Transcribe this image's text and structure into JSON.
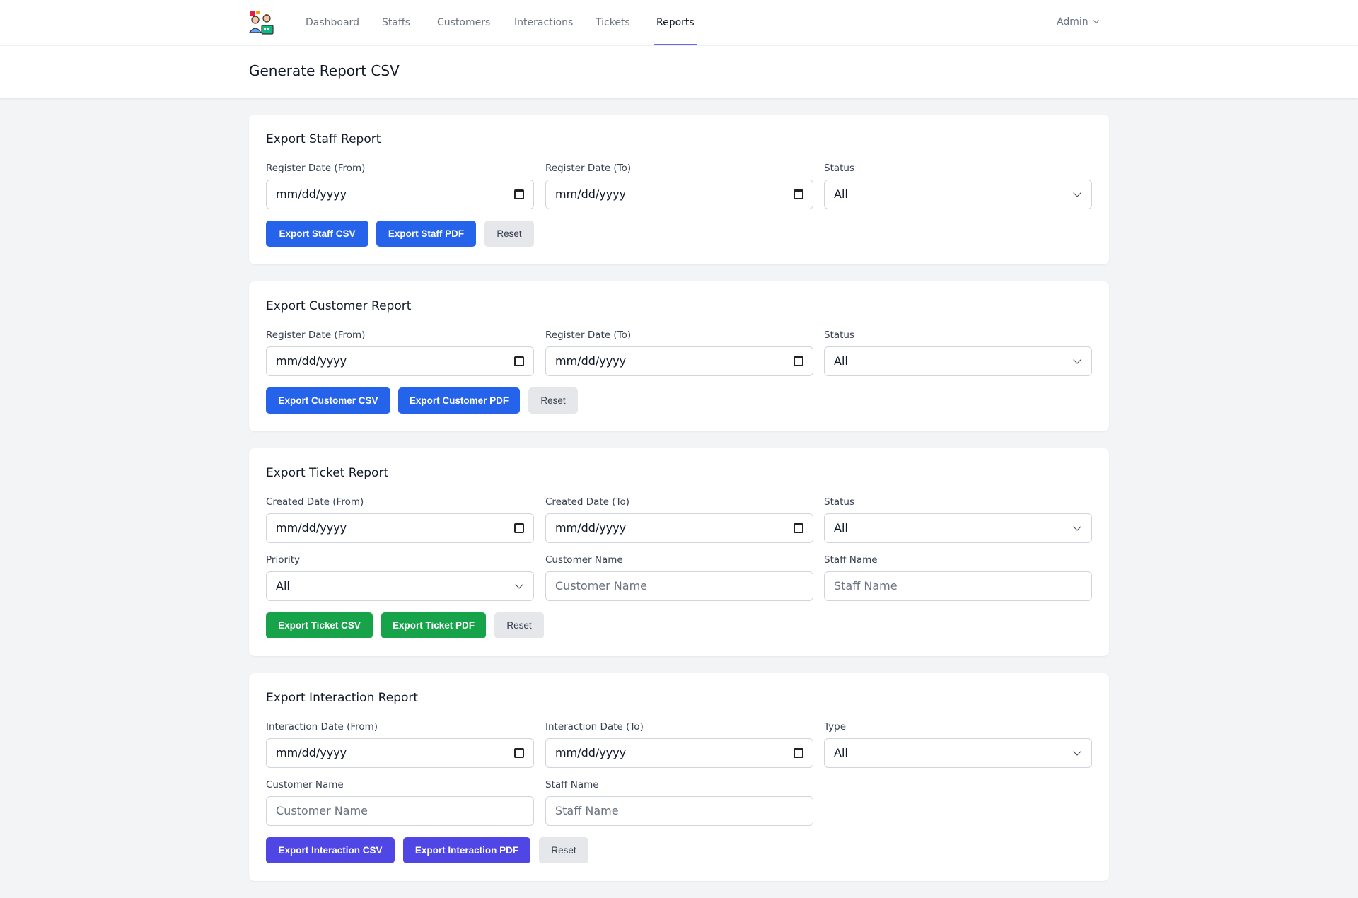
{
  "nav": {
    "items": [
      {
        "label": "Dashboard"
      },
      {
        "label": "Staffs"
      },
      {
        "label": "Customers"
      },
      {
        "label": "Interactions"
      },
      {
        "label": "Tickets"
      },
      {
        "label": "Reports"
      }
    ],
    "active": "Reports",
    "user": "Admin"
  },
  "page": {
    "title": "Generate Report CSV"
  },
  "date_placeholder": "mm/dd/yyyy",
  "staff_report": {
    "title": "Export Staff Report",
    "from_label": "Register Date (From)",
    "to_label": "Register Date (To)",
    "status_label": "Status",
    "status_value": "All",
    "csv_button": "Export Staff CSV",
    "pdf_button": "Export Staff PDF",
    "reset_button": "Reset"
  },
  "customer_report": {
    "title": "Export Customer Report",
    "from_label": "Register Date (From)",
    "to_label": "Register Date (To)",
    "status_label": "Status",
    "status_value": "All",
    "csv_button": "Export Customer CSV",
    "pdf_button": "Export Customer PDF",
    "reset_button": "Reset"
  },
  "ticket_report": {
    "title": "Export Ticket Report",
    "from_label": "Created Date (From)",
    "to_label": "Created Date (To)",
    "status_label": "Status",
    "status_value": "All",
    "priority_label": "Priority",
    "priority_value": "All",
    "customer_label": "Customer Name",
    "customer_placeholder": "Customer Name",
    "staff_label": "Staff Name",
    "staff_placeholder": "Staff Name",
    "csv_button": "Export Ticket CSV",
    "pdf_button": "Export Ticket PDF",
    "reset_button": "Reset"
  },
  "interaction_report": {
    "title": "Export Interaction Report",
    "from_label": "Interaction Date (From)",
    "to_label": "Interaction Date (To)",
    "type_label": "Type",
    "type_value": "All",
    "customer_label": "Customer Name",
    "customer_placeholder": "Customer Name",
    "staff_label": "Staff Name",
    "staff_placeholder": "Staff Name",
    "csv_button": "Export Interaction CSV",
    "pdf_button": "Export Interaction PDF",
    "reset_button": "Reset"
  },
  "colors": {
    "staff_buttons": "#2563eb",
    "customer_buttons": "#2563eb",
    "ticket_buttons": "#16a34a",
    "interaction_buttons": "#4f46e5",
    "active_nav_underline": "#6366f1"
  }
}
